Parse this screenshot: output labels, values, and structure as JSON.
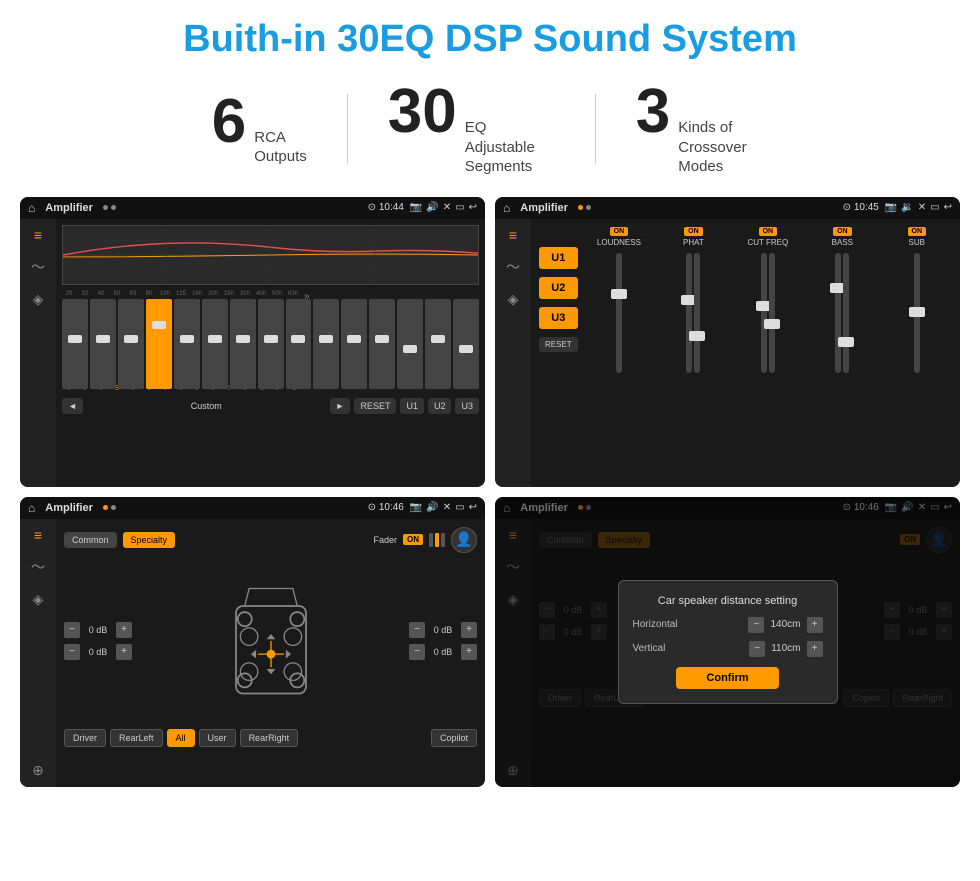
{
  "page": {
    "title": "Buith-in 30EQ DSP Sound System"
  },
  "stats": [
    {
      "number": "6",
      "text": "RCA\nOutputs"
    },
    {
      "number": "30",
      "text": "EQ Adjustable\nSegments"
    },
    {
      "number": "3",
      "text": "Kinds of\nCrossover Modes"
    }
  ],
  "screens": [
    {
      "id": "eq-screen",
      "app": "Amplifier",
      "time": "10:44",
      "type": "eq"
    },
    {
      "id": "crossover-screen",
      "app": "Amplifier",
      "time": "10:45",
      "type": "crossover"
    },
    {
      "id": "fader-screen",
      "app": "Amplifier",
      "time": "10:46",
      "type": "fader"
    },
    {
      "id": "dialog-screen",
      "app": "Amplifier",
      "time": "10:46",
      "type": "fader-dialog"
    }
  ],
  "eq": {
    "frequencies": [
      "25",
      "32",
      "40",
      "50",
      "63",
      "80",
      "100",
      "125",
      "160",
      "200",
      "250",
      "320",
      "400",
      "500",
      "630"
    ],
    "values": [
      "0",
      "0",
      "0",
      "5",
      "0",
      "0",
      "0",
      "0",
      "0",
      "0",
      "0",
      "0",
      "-1",
      "0",
      "-1"
    ],
    "sliderPositions": [
      50,
      50,
      50,
      35,
      50,
      50,
      50,
      50,
      50,
      50,
      50,
      50,
      60,
      50,
      60
    ],
    "presets": [
      "Custom",
      "RESET",
      "U1",
      "U2",
      "U3"
    ],
    "mode_label": "Custom"
  },
  "crossover": {
    "u_buttons": [
      "U1",
      "U2",
      "U3"
    ],
    "channels": [
      {
        "name": "LOUDNESS",
        "on": true
      },
      {
        "name": "PHAT",
        "on": true
      },
      {
        "name": "CUT FREQ",
        "on": true
      },
      {
        "name": "BASS",
        "on": true
      },
      {
        "name": "SUB",
        "on": true
      }
    ]
  },
  "fader": {
    "tabs": [
      "Common",
      "Specialty"
    ],
    "fader_label": "Fader",
    "on_text": "ON",
    "db_values": [
      "0 dB",
      "0 dB",
      "0 dB",
      "0 dB"
    ],
    "bottom_buttons": [
      "Driver",
      "RearLeft",
      "All",
      "User",
      "RearRight",
      "Copilot"
    ]
  },
  "dialog": {
    "title": "Car speaker distance setting",
    "horizontal_label": "Horizontal",
    "horizontal_value": "140cm",
    "vertical_label": "Vertical",
    "vertical_value": "110cm",
    "confirm_label": "Confirm"
  },
  "colors": {
    "accent": "#ff9900",
    "title_blue": "#1a9de0",
    "bg_dark": "#1a1a1a",
    "text_light": "#cccccc"
  }
}
